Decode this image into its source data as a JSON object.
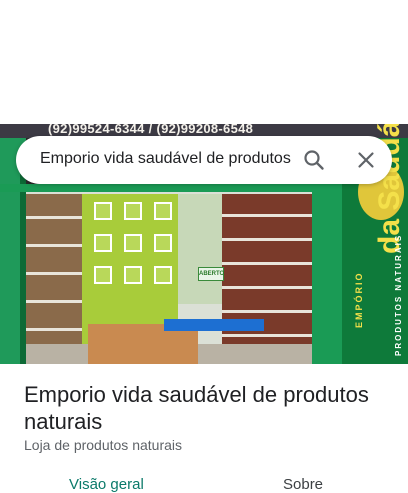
{
  "search": {
    "query": "Emporio vida saudável de produtos"
  },
  "photo": {
    "sign_text": "(92)99524-6344 / (92)99208-6548",
    "open_sign": "ABERTO",
    "banner_line1": "EMPÓRIO",
    "banner_line2": "da Saudável",
    "banner_line3": "PRODUTOS NATURAIS"
  },
  "place": {
    "title": "Emporio vida saudável de produtos naturais",
    "category": "Loja de produtos naturais"
  },
  "tabs": [
    {
      "label": "Visão geral",
      "active": true
    },
    {
      "label": "Sobre",
      "active": false
    }
  ],
  "colors": {
    "active_tab": "#0b7a6a",
    "store_green": "#1a9b55",
    "brand_yellow": "#f4e04a"
  },
  "icons": [
    "search-icon",
    "close-icon"
  ]
}
